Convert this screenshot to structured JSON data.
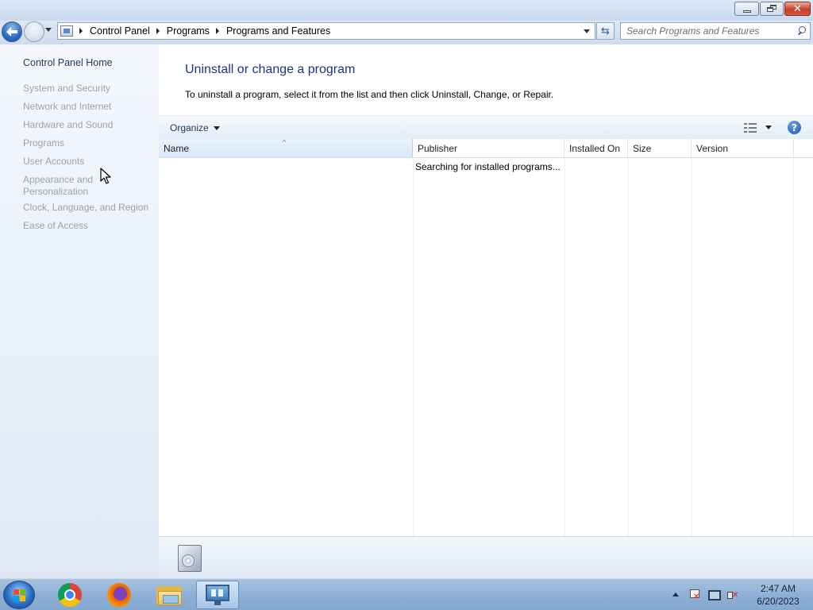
{
  "window": {
    "caption_buttons": {
      "minimize": "minimize",
      "maximize": "restore",
      "close": "close"
    }
  },
  "navigation": {
    "breadcrumbs": [
      "Control Panel",
      "Programs",
      "Programs and Features"
    ],
    "search_placeholder": "Search Programs and Features"
  },
  "sidebar": {
    "home": "Control Panel Home",
    "items": [
      {
        "label": "System and Security"
      },
      {
        "label": "Network and Internet"
      },
      {
        "label": "Hardware and Sound"
      },
      {
        "label": "Programs"
      },
      {
        "label": "User Accounts"
      },
      {
        "label": "Appearance and Personalization"
      },
      {
        "label": "Clock, Language, and Region"
      },
      {
        "label": "Ease of Access"
      }
    ]
  },
  "main": {
    "title": "Uninstall or change a program",
    "description": "To uninstall a program, select it from the list and then click Uninstall, Change, or Repair.",
    "toolbar": {
      "organize": "Organize",
      "help": "?"
    },
    "columns": {
      "name": "Name",
      "publisher": "Publisher",
      "installed_on": "Installed On",
      "size": "Size",
      "version": "Version"
    },
    "status": "Searching for installed programs..."
  },
  "taskbar": {
    "apps": [
      "start-icon",
      "chrome-icon",
      "firefox-icon",
      "explorer-icon",
      "control-panel-icon"
    ],
    "clock": {
      "time": "2:47 AM",
      "date": "6/20/2023"
    }
  },
  "colors": {
    "title_blue": "#1e3287",
    "link_dark": "#1e395b",
    "disabled_gray": "#9aa2ad",
    "taskbar": "#8eb0d6"
  }
}
